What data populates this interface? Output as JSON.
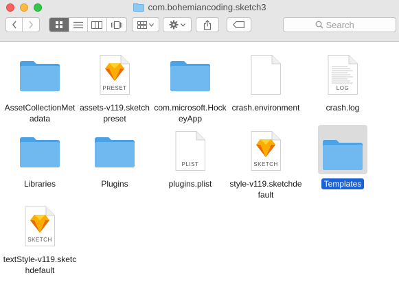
{
  "window": {
    "title": "com.bohemiancoding.sketch3"
  },
  "toolbar": {
    "search_placeholder": "Search"
  },
  "colors": {
    "folder": "#6fb9f0",
    "folder_dark": "#4aa3e6",
    "selection": "#1a62d6",
    "sketch": "#f7b500"
  },
  "files": [
    {
      "name": "AssetCollectionMetadata",
      "label": "AssetCollectionM etadata",
      "kind": "folder"
    },
    {
      "name": "assets-v119.sketchpreset",
      "label": "assets- v119.sketchpreset",
      "kind": "sketch-doc",
      "badge": "PRESET"
    },
    {
      "name": "com.microsoft.HockeyApp",
      "label": "com.microsoft.Ho ckeyApp",
      "kind": "folder"
    },
    {
      "name": "crash.environment",
      "label": "crash.environmen t",
      "kind": "blank-doc"
    },
    {
      "name": "crash.log",
      "label": "crash.log",
      "kind": "log-doc",
      "badge": "LOG"
    },
    {
      "name": "Libraries",
      "label": "Libraries",
      "kind": "folder"
    },
    {
      "name": "Plugins",
      "label": "Plugins",
      "kind": "folder"
    },
    {
      "name": "plugins.plist",
      "label": "plugins.plist",
      "kind": "plist-doc",
      "badge": "PLIST"
    },
    {
      "name": "style-v119.sketchdefault",
      "label": "style- v119.sketchdefault",
      "kind": "sketch-doc",
      "badge": "SKETCH"
    },
    {
      "name": "Templates",
      "label": "Templates",
      "kind": "folder",
      "selected": true
    },
    {
      "name": "textStyle-v119.sketchdefault",
      "label": "textStyle- v119.sketchdefault",
      "kind": "sketch-doc",
      "badge": "SKETCH"
    }
  ]
}
